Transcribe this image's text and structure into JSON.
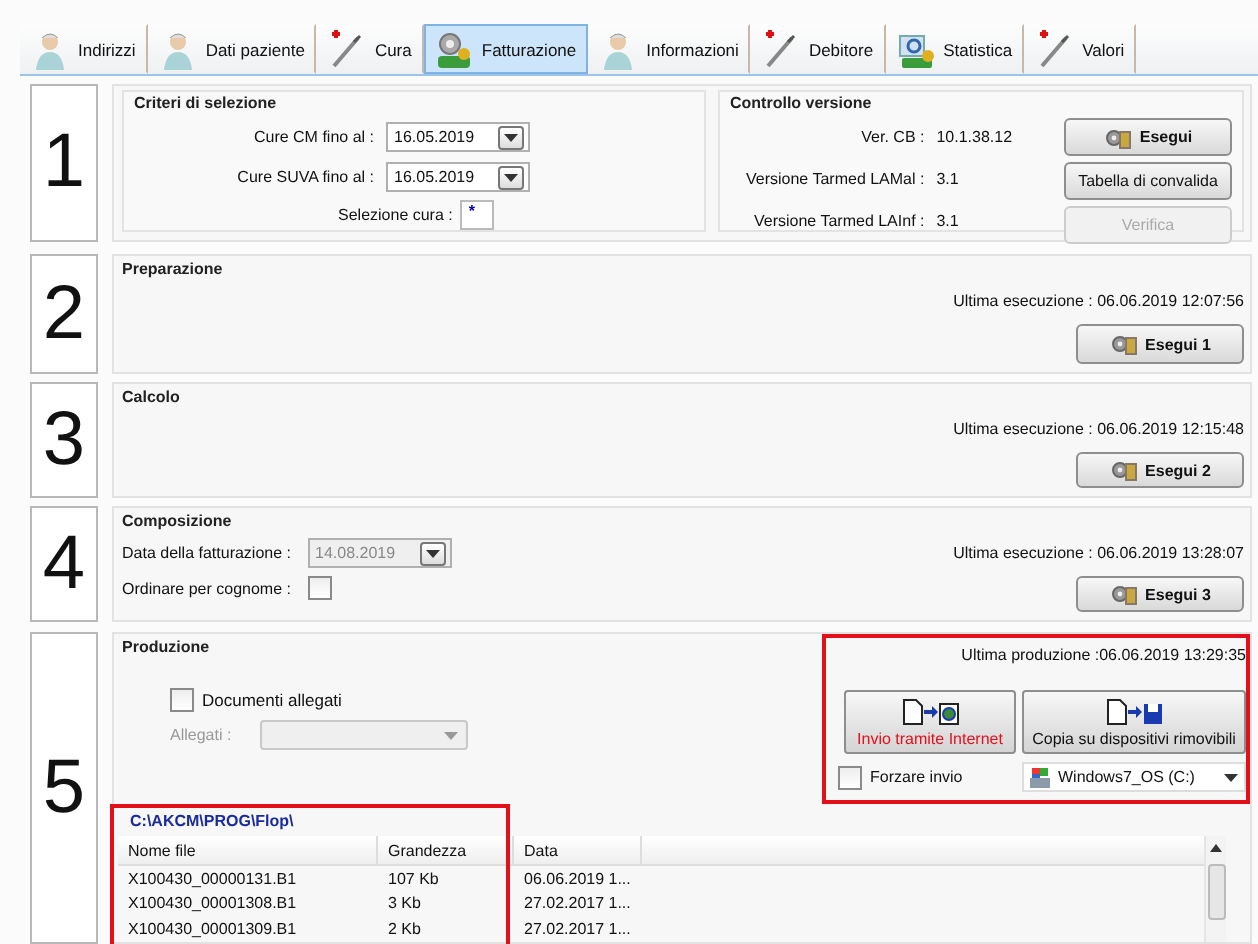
{
  "tabs": [
    {
      "label": "Indirizzi",
      "kind": "person",
      "selected": false
    },
    {
      "label": "Dati paziente",
      "kind": "person",
      "selected": false
    },
    {
      "label": "Cura",
      "kind": "syringe",
      "selected": false
    },
    {
      "label": "Fatturazione",
      "kind": "gears",
      "selected": true
    },
    {
      "label": "Informazioni",
      "kind": "person",
      "selected": false
    },
    {
      "label": "Debitore",
      "kind": "syringe",
      "selected": false
    },
    {
      "label": "Statistica",
      "kind": "stats",
      "selected": false
    },
    {
      "label": "Valori",
      "kind": "syringe",
      "selected": false
    }
  ],
  "step1": {
    "number": "1",
    "criteria": {
      "title": "Criteri di selezione",
      "dates": [
        {
          "label": "Cure CM fino al :",
          "value": "16.05.2019"
        },
        {
          "label": "Cure SUVA fino al :",
          "value": "16.05.2019"
        }
      ],
      "selection": {
        "label": "Selezione cura :",
        "value": "*"
      }
    },
    "version": {
      "title": "Controllo versione",
      "rows": [
        {
          "label": "Ver. CB :",
          "value": "10.1.38.12"
        },
        {
          "label": "Versione Tarmed LAMal :",
          "value": "3.1"
        },
        {
          "label": "Versione Tarmed LAInf :",
          "value": "3.1"
        }
      ],
      "buttons": [
        {
          "label": "Esegui",
          "icon": true,
          "disabled": false
        },
        {
          "label": "Tabella di convalida",
          "icon": false,
          "disabled": false
        },
        {
          "label": "Verifica",
          "icon": false,
          "disabled": true
        }
      ]
    }
  },
  "steps": [
    {
      "number": "2",
      "title": "Preparazione",
      "last_run": "Ultima esecuzione : 06.06.2019 12:07:56",
      "button": "Esegui 1"
    },
    {
      "number": "3",
      "title": "Calcolo",
      "last_run": "Ultima esecuzione : 06.06.2019 12:15:48",
      "button": "Esegui 2"
    },
    {
      "number": "4",
      "title": "Composizione",
      "last_run": "Ultima esecuzione : 06.06.2019 13:28:07",
      "button": "Esegui 3",
      "billing_date": {
        "label": "Data della fatturazione :",
        "value": "14.08.2019",
        "disabled": true
      },
      "sort": {
        "label": "Ordinare per cognome :",
        "checked": false
      }
    }
  ],
  "step5": {
    "number": "5",
    "title": "Produzione",
    "attachments": {
      "checkbox": {
        "label": "Documenti allegati",
        "checked": false
      },
      "select": {
        "label": "Allegati :",
        "disabled": true
      }
    },
    "output": {
      "highlighted": true,
      "last_production": "Ultima produzione :06.06.2019 13:29:35",
      "buttons": [
        {
          "label": "Invio tramite Internet",
          "kind": "internet",
          "warning": true
        },
        {
          "label": "Copia su dispositivi rimovibili",
          "kind": "removable",
          "warning": false
        }
      ],
      "force": {
        "label": "Forzare invio",
        "checked": false
      },
      "drive": "Windows7_OS (C:)"
    },
    "files": {
      "highlighted": true,
      "path": "C:\\AKCM\\PROG\\Flop\\",
      "columns": [
        "Nome file",
        "Grandezza",
        "Data"
      ],
      "rows": [
        [
          "X100430_00000131.B1",
          "107 Kb",
          "06.06.2019 1..."
        ],
        [
          "X100430_00001308.B1",
          "3 Kb",
          "27.02.2017 1..."
        ],
        [
          "X100430_00001309.B1",
          "2 Kb",
          "27.02.2017 1..."
        ]
      ]
    }
  }
}
